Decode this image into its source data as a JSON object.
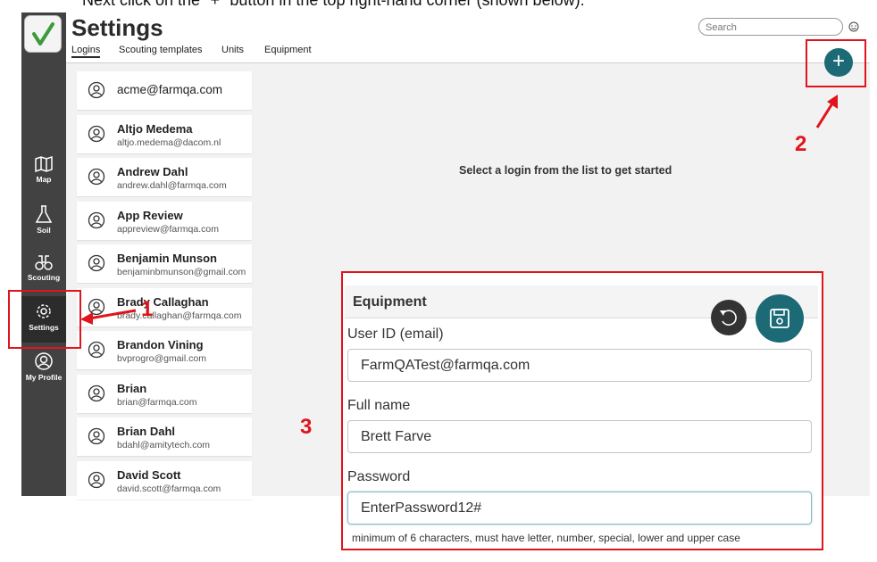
{
  "instruction_text": "Next click on the \"+\" button in the top right-hand corner (shown below):",
  "sidebar": {
    "items": [
      {
        "label": "Map",
        "icon": "map-icon"
      },
      {
        "label": "Soil",
        "icon": "flask-icon"
      },
      {
        "label": "Scouting",
        "icon": "binoculars-icon"
      },
      {
        "label": "Settings",
        "icon": "gear-icon"
      },
      {
        "label": "My Profile",
        "icon": "user-circle-icon"
      }
    ]
  },
  "header": {
    "title": "Settings",
    "tabs": [
      "Logins",
      "Scouting templates",
      "Units",
      "Equipment"
    ],
    "search_placeholder": "Search",
    "add_label": "+"
  },
  "main": {
    "empty_message": "Select a login from the list to get started"
  },
  "logins": [
    {
      "name": "acme@farmqa.com",
      "email": ""
    },
    {
      "name": "Altjo Medema",
      "email": "altjo.medema@dacom.nl"
    },
    {
      "name": "Andrew Dahl",
      "email": "andrew.dahl@farmqa.com"
    },
    {
      "name": "App Review",
      "email": "appreview@farmqa.com"
    },
    {
      "name": "Benjamin Munson",
      "email": "benjaminbmunson@gmail.com"
    },
    {
      "name": "Brady Callaghan",
      "email": "brady.callaghan@farmqa.com"
    },
    {
      "name": "Brandon Vining",
      "email": "bvprogro@gmail.com"
    },
    {
      "name": "Brian",
      "email": "brian@farmqa.com"
    },
    {
      "name": "Brian Dahl",
      "email": "bdahl@amitytech.com"
    },
    {
      "name": "David Scott",
      "email": "david.scott@farmqa.com"
    }
  ],
  "annotations": {
    "step1": "1",
    "step2": "2",
    "step3": "3"
  },
  "form": {
    "title": "Equipment",
    "user_id_label": "User ID (email)",
    "user_id_value": "FarmQATest@farmqa.com",
    "full_name_label": "Full name",
    "full_name_value": "Brett Farve",
    "password_label": "Password",
    "password_value": "EnterPassword12#",
    "password_hint": "minimum of 6 characters, must have letter, number, special, lower and upper case"
  },
  "colors": {
    "accent": "#1b6a75",
    "sidebar": "#424242",
    "annotation_red": "#e0141c"
  }
}
